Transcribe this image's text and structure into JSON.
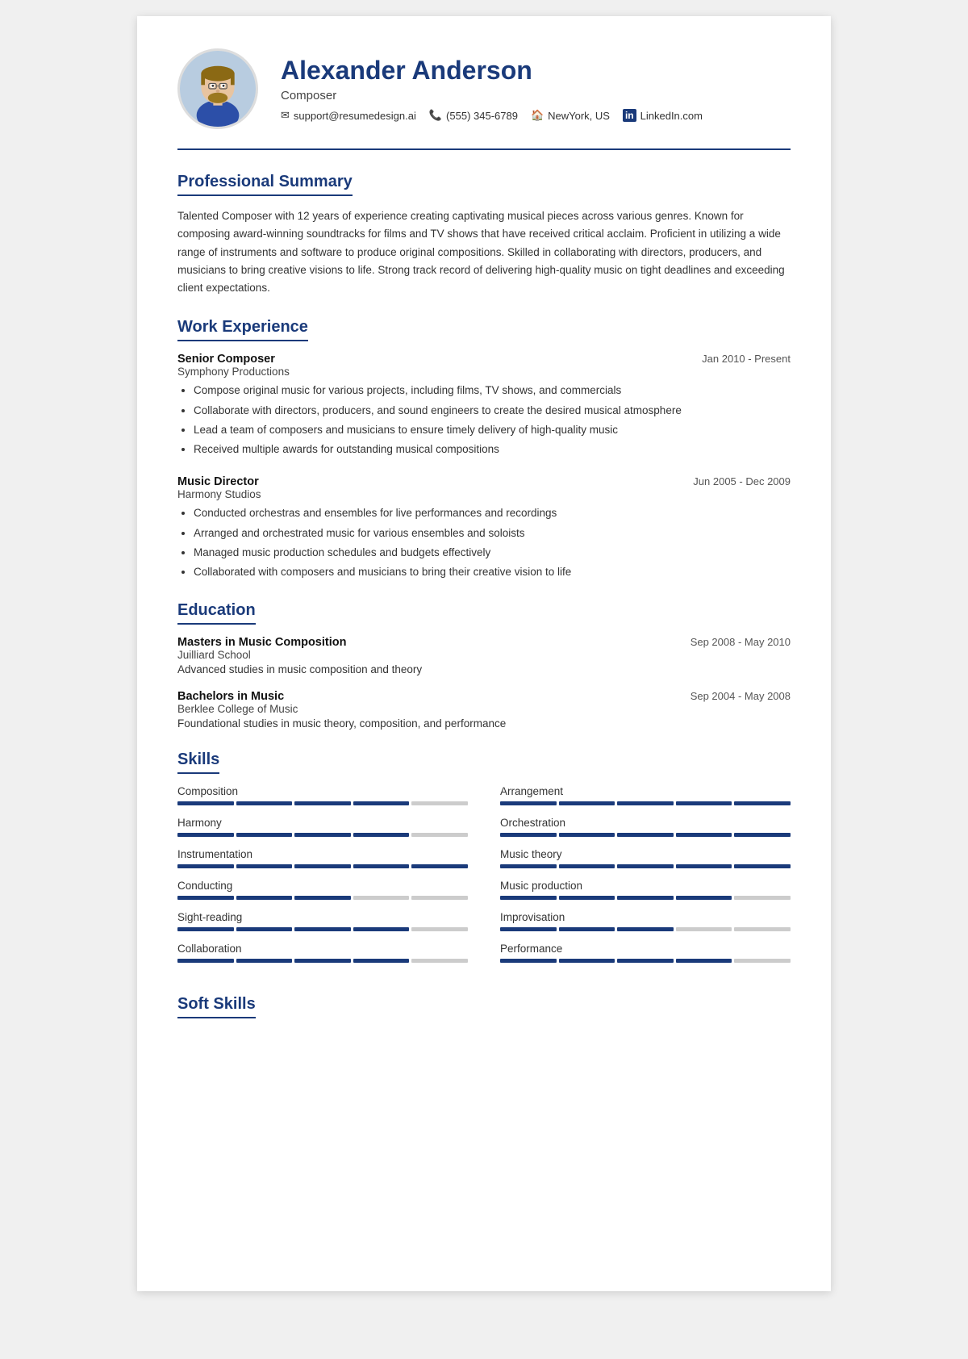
{
  "header": {
    "name": "Alexander Anderson",
    "title": "Composer",
    "contacts": [
      {
        "icon": "✉",
        "text": "support@resumedesign.ai",
        "type": "email"
      },
      {
        "icon": "📞",
        "text": "(555) 345-6789",
        "type": "phone"
      },
      {
        "icon": "🏠",
        "text": "NewYork, US",
        "type": "location"
      },
      {
        "icon": "in",
        "text": "LinkedIn.com",
        "type": "linkedin"
      }
    ]
  },
  "sections": {
    "summary": {
      "title": "Professional Summary",
      "text": "Talented Composer with 12 years of experience creating captivating musical pieces across various genres. Known for composing award-winning soundtracks for films and TV shows that have received critical acclaim. Proficient in utilizing a wide range of instruments and software to produce original compositions. Skilled in collaborating with directors, producers, and musicians to bring creative visions to life. Strong track record of delivering high-quality music on tight deadlines and exceeding client expectations."
    },
    "work_experience": {
      "title": "Work Experience",
      "jobs": [
        {
          "title": "Senior Composer",
          "company": "Symphony Productions",
          "date": "Jan 2010 - Present",
          "bullets": [
            "Compose original music for various projects, including films, TV shows, and commercials",
            "Collaborate with directors, producers, and sound engineers to create the desired musical atmosphere",
            "Lead a team of composers and musicians to ensure timely delivery of high-quality music",
            "Received multiple awards for outstanding musical compositions"
          ]
        },
        {
          "title": "Music Director",
          "company": "Harmony Studios",
          "date": "Jun 2005 - Dec 2009",
          "bullets": [
            "Conducted orchestras and ensembles for live performances and recordings",
            "Arranged and orchestrated music for various ensembles and soloists",
            "Managed music production schedules and budgets effectively",
            "Collaborated with composers and musicians to bring their creative vision to life"
          ]
        }
      ]
    },
    "education": {
      "title": "Education",
      "entries": [
        {
          "degree": "Masters in Music Composition",
          "school": "Juilliard School",
          "date": "Sep 2008 - May 2010",
          "desc": "Advanced studies in music composition and theory"
        },
        {
          "degree": "Bachelors in Music",
          "school": "Berklee College of Music",
          "date": "Sep 2004 - May 2008",
          "desc": "Foundational studies in music theory, composition, and performance"
        }
      ]
    },
    "skills": {
      "title": "Skills",
      "items": [
        {
          "name": "Composition",
          "level": 4
        },
        {
          "name": "Arrangement",
          "level": 5
        },
        {
          "name": "Harmony",
          "level": 4
        },
        {
          "name": "Orchestration",
          "level": 5
        },
        {
          "name": "Instrumentation",
          "level": 5
        },
        {
          "name": "Music theory",
          "level": 5
        },
        {
          "name": "Conducting",
          "level": 3
        },
        {
          "name": "Music production",
          "level": 4
        },
        {
          "name": "Sight-reading",
          "level": 4
        },
        {
          "name": "Improvisation",
          "level": 3
        },
        {
          "name": "Collaboration",
          "level": 4
        },
        {
          "name": "Performance",
          "level": 4
        }
      ]
    },
    "soft_skills": {
      "title": "Soft Skills"
    }
  }
}
